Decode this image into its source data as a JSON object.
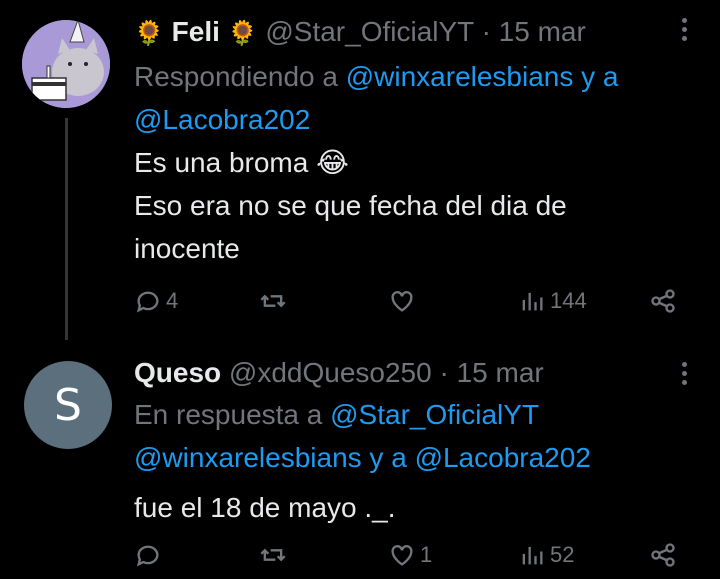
{
  "tweets": [
    {
      "display_name": "Feli",
      "handle": "@Star_OficialYT",
      "sep": "·",
      "date": "15 mar",
      "reply_prefix": "Respondiendo a",
      "reply_to_1": "@winxarelesbians",
      "reply_conj": "y a",
      "reply_to_2": "@Lacobra202",
      "text_line1": "Es una broma 😂",
      "text_line2": "Eso era no se que fecha del dia de",
      "text_line3": "inocente",
      "stats": {
        "replies": "4",
        "retweets": "",
        "likes": "",
        "views": "144"
      }
    },
    {
      "display_name": "Queso",
      "avatar_letter": "S",
      "handle": "@xddQueso250",
      "sep": "·",
      "date": "15 mar",
      "reply_prefix": "En respuesta a",
      "reply_to_1": "@Star_OficialYT",
      "reply_to_2": "@winxarelesbians",
      "reply_conj": "y a",
      "reply_to_3": "@Lacobra202",
      "text_line1": "fue el 18 de mayo ._.",
      "stats": {
        "replies": "",
        "retweets": "",
        "likes": "1",
        "views": "52"
      }
    }
  ],
  "icons": [
    "reply-icon",
    "retweet-icon",
    "like-icon",
    "views-icon",
    "share-icon",
    "more-icon",
    "sunflower-icon"
  ],
  "colors": {
    "background": "#000000",
    "link": "#1d9bf0",
    "muted": "#71767b",
    "text": "#e7e9ea"
  }
}
